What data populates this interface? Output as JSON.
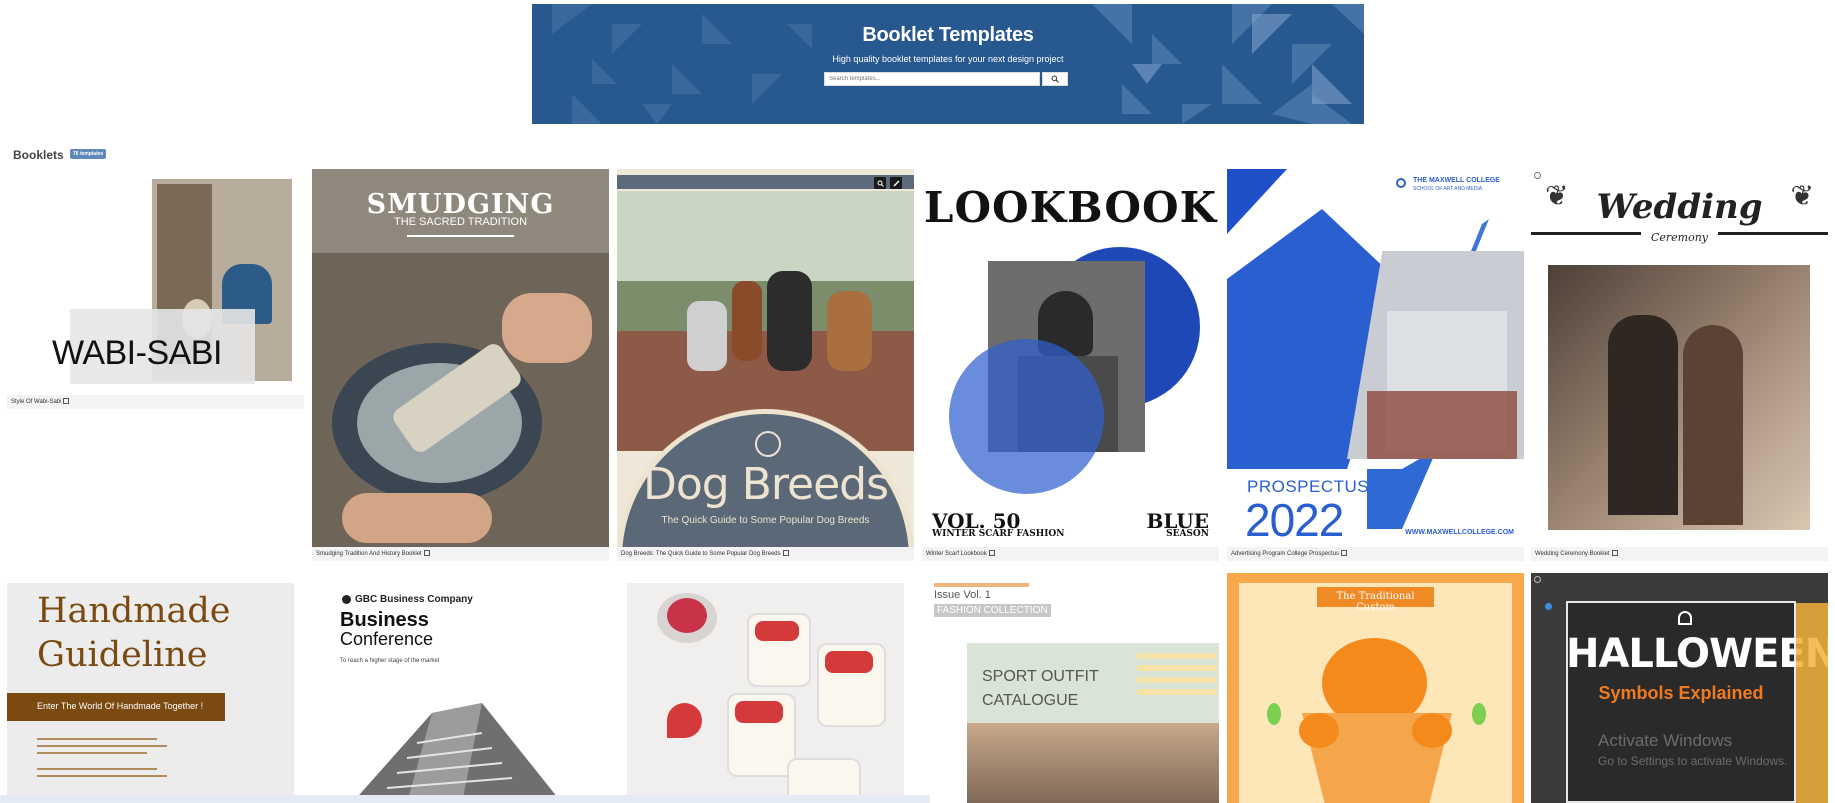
{
  "hero": {
    "title": "Booklet Templates",
    "subtitle": "High quality booklet templates for your next design project",
    "search_placeholder": "Search templates...",
    "search_icon": "magnifier-icon",
    "background_color": "#27588f"
  },
  "section": {
    "title": "Booklets",
    "badge": "76 templates"
  },
  "cards": [
    {
      "caption": "Style Of Wabi-Sabi",
      "cover_text": "WABI-SABI"
    },
    {
      "caption": "Smudging Tradition And History Booklet",
      "cover_title": "SMUDGING",
      "cover_sub": "THE SACRED TRADITION"
    },
    {
      "caption": "Dog Breeds: The Quick Guide to Some Popular Dog Breeds",
      "cover_title": "Dog Breeds",
      "cover_sub": "The Quick Guide to Some Popular Dog Breeds"
    },
    {
      "caption": "Winter Scarf Lookbook",
      "cover_title": "LOOKBOOK",
      "vol": "VOL. 50",
      "vol_sub": "WINTER SCARF FASHION",
      "blue": "BLUE",
      "season": "SEASON"
    },
    {
      "caption": "Advertising Program College Prospectus",
      "college": "THE MAXWELL COLLEGE",
      "college_sub": "SCHOOL OF ART AND MEDIA",
      "prospectus": "PROSPECTUS",
      "year": "2022",
      "url": "WWW.MAXWELLCOLLEGE.COM"
    },
    {
      "caption": "Wedding Ceremony Booklet",
      "cover_title": "Wedding",
      "cover_sub": "Ceremony"
    },
    {
      "title_line1": "Handmade",
      "title_line2": "Guideline",
      "banner": "Enter The World Of Handmade Together !"
    },
    {
      "company": "GBC Business Company",
      "title_line1": "Business",
      "title_line2": "Conference",
      "sub": "To reach a higher stage of the market"
    },
    {},
    {
      "issue": "Issue Vol. 1",
      "tag": "FASHION COLLECTION",
      "title_line1": "SPORT OUTFIT",
      "title_line2": "CATALOGUE"
    },
    {
      "banner": "The Traditional Custom"
    },
    {
      "title": "HALLOWEEN",
      "sub": "Symbols Explained"
    }
  ],
  "overlay": {
    "line1": "Activate Windows",
    "line2": "Go to Settings to activate Windows."
  }
}
